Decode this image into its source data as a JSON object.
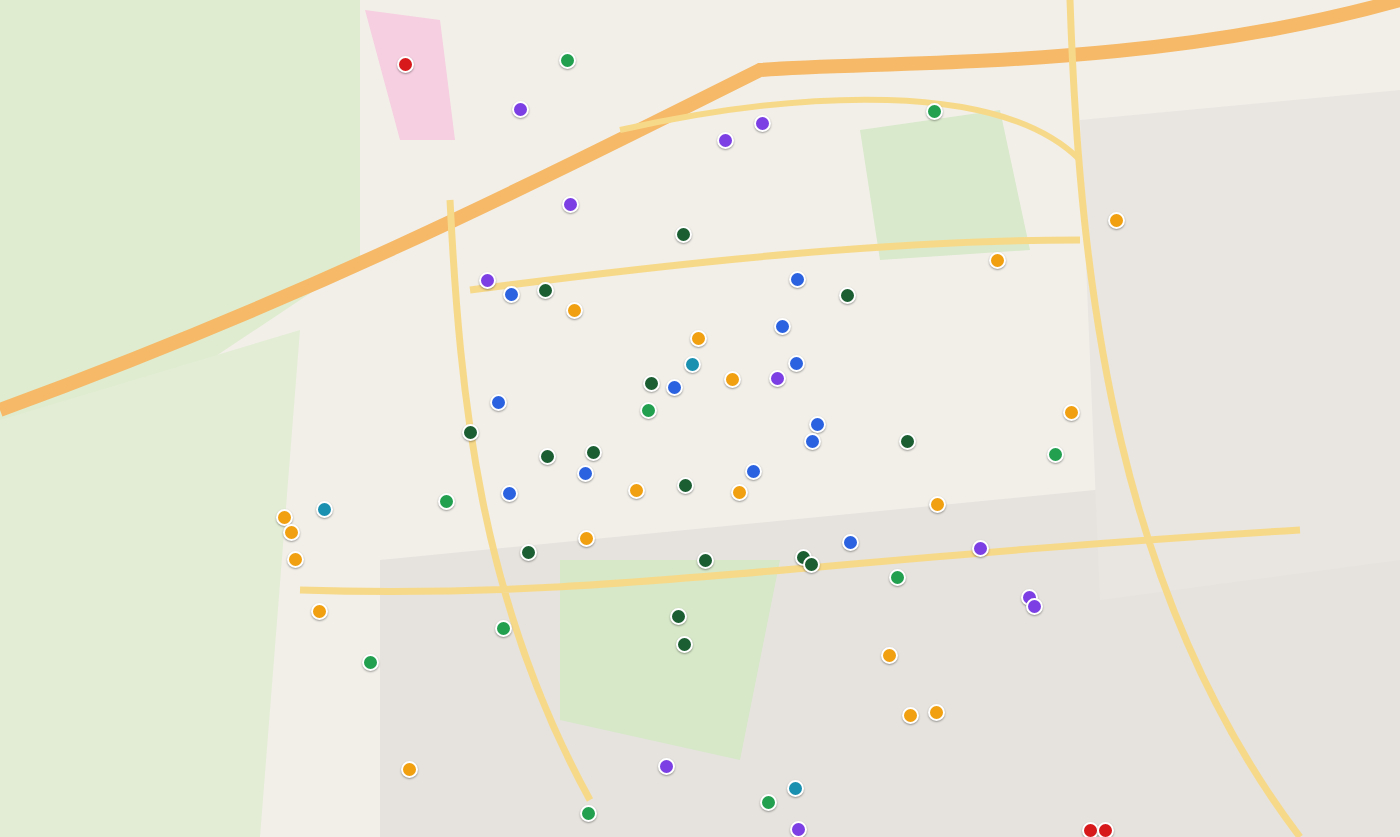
{
  "markers": [
    {
      "color": "#d7191c"
    },
    {
      "color": "#7c3fe4"
    },
    {
      "color": "#7c3fe4"
    },
    {
      "color": "#7c3fe4"
    },
    {
      "color": "#7c3fe4"
    },
    {
      "color": "#7c3fe4"
    },
    {
      "color": "#7c3fe4"
    },
    {
      "color": "#7c3fe4"
    },
    {
      "color": "#7c3fe4"
    },
    {
      "color": "#7c3fe4"
    },
    {
      "color": "#7c3fe4"
    },
    {
      "color": "#7c3fe4"
    },
    {
      "color": "#22a050"
    },
    {
      "color": "#22a050"
    },
    {
      "color": "#22a050"
    },
    {
      "color": "#22a050"
    },
    {
      "color": "#22a050"
    },
    {
      "color": "#22a050"
    },
    {
      "color": "#22a050"
    },
    {
      "color": "#22a050"
    },
    {
      "color": "#22a050"
    },
    {
      "color": "#22a050"
    },
    {
      "color": "#1b5e32"
    },
    {
      "color": "#1b5e32"
    },
    {
      "color": "#1b5e32"
    },
    {
      "color": "#1b5e32"
    },
    {
      "color": "#1b5e32"
    },
    {
      "color": "#1b5e32"
    },
    {
      "color": "#1b5e32"
    },
    {
      "color": "#1b5e32"
    },
    {
      "color": "#1b5e32"
    },
    {
      "color": "#1b5e32"
    },
    {
      "color": "#1b5e32"
    },
    {
      "color": "#1b5e32"
    },
    {
      "color": "#1b5e32"
    },
    {
      "color": "#1b5e32"
    },
    {
      "color": "#1b5e32"
    },
    {
      "color": "#2a62e0"
    },
    {
      "color": "#2a62e0"
    },
    {
      "color": "#2a62e0"
    },
    {
      "color": "#2a62e0"
    },
    {
      "color": "#2a62e0"
    },
    {
      "color": "#2a62e0"
    },
    {
      "color": "#2a62e0"
    },
    {
      "color": "#2a62e0"
    },
    {
      "color": "#2a62e0"
    },
    {
      "color": "#2a62e0"
    },
    {
      "color": "#2a62e0"
    },
    {
      "color": "#2a62e0"
    },
    {
      "color": "#f0a010"
    },
    {
      "color": "#f0a010"
    },
    {
      "color": "#f0a010"
    },
    {
      "color": "#f0a010"
    },
    {
      "color": "#f0a010"
    },
    {
      "color": "#f0a010"
    },
    {
      "color": "#f0a010"
    },
    {
      "color": "#f0a010"
    },
    {
      "color": "#f0a010"
    },
    {
      "color": "#f0a010"
    },
    {
      "color": "#f0a010"
    },
    {
      "color": "#f0a010"
    },
    {
      "color": "#f0a010"
    },
    {
      "color": "#f0a010"
    },
    {
      "color": "#f0a010"
    },
    {
      "color": "#f0a010"
    },
    {
      "color": "#f0a010"
    },
    {
      "color": "#f0a010"
    },
    {
      "color": "#1a90b0"
    },
    {
      "color": "#1a90b0"
    },
    {
      "color": "#1a90b0"
    },
    {
      "color": "#d7191c"
    },
    {
      "color": "#d7191c"
    }
  ]
}
